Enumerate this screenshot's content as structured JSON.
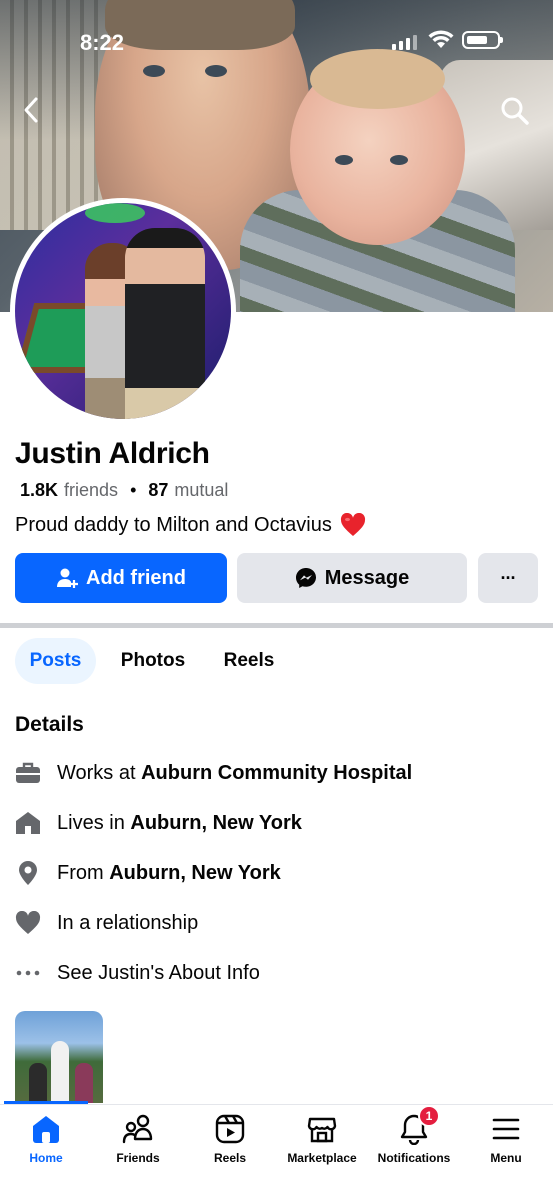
{
  "status_bar": {
    "time": "8:22"
  },
  "profile": {
    "name": "Justin Aldrich",
    "friends_count": "1.8K",
    "friends_label": "friends",
    "separator": "•",
    "mutual_count": "87",
    "mutual_label": "mutual",
    "bio": "Proud daddy to Milton and Octavius"
  },
  "actions": {
    "add_friend": "Add friend",
    "message": "Message",
    "more": "···"
  },
  "tabs": [
    {
      "label": "Posts",
      "active": true
    },
    {
      "label": "Photos",
      "active": false
    },
    {
      "label": "Reels",
      "active": false
    }
  ],
  "details": {
    "title": "Details",
    "items": [
      {
        "icon": "briefcase-icon",
        "prefix": "Works at ",
        "bold": "Auburn Community Hospital"
      },
      {
        "icon": "home-icon",
        "prefix": "Lives in ",
        "bold": "Auburn, New York"
      },
      {
        "icon": "location-pin-icon",
        "prefix": "From ",
        "bold": "Auburn, New York"
      },
      {
        "icon": "heart-icon",
        "prefix": "In a relationship",
        "bold": ""
      },
      {
        "icon": "more-dots-icon",
        "prefix": "See Justin's About Info",
        "bold": ""
      }
    ]
  },
  "bottom_nav": [
    {
      "label": "Home",
      "icon": "home-icon",
      "active": true
    },
    {
      "label": "Friends",
      "icon": "friends-icon",
      "active": false
    },
    {
      "label": "Reels",
      "icon": "reels-icon",
      "active": false
    },
    {
      "label": "Marketplace",
      "icon": "marketplace-icon",
      "active": false
    },
    {
      "label": "Notifications",
      "icon": "bell-icon",
      "active": false,
      "badge": "1"
    },
    {
      "label": "Menu",
      "icon": "hamburger-icon",
      "active": false
    }
  ],
  "colors": {
    "accent": "#0866ff",
    "button_gray": "#e4e6eb",
    "badge_red": "#e41e3f",
    "secondary_text": "#65676b"
  }
}
